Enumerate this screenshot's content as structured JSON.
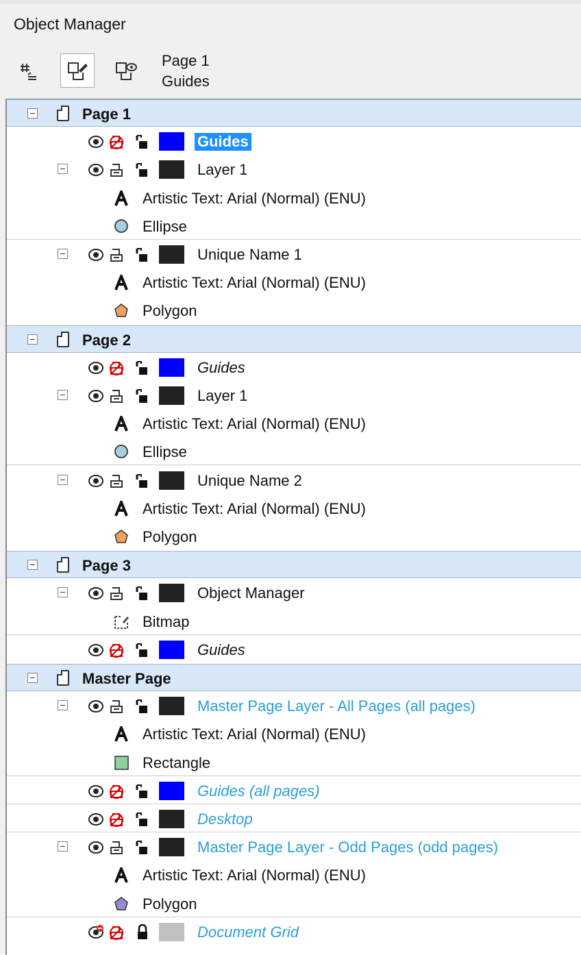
{
  "panel": {
    "title": "Object Manager"
  },
  "toolbar": {
    "info_line1": "Page 1",
    "info_line2": "Guides",
    "buttons": [
      "object-properties",
      "layer-manager-view",
      "show-hide-view"
    ]
  },
  "colors": {
    "page_row_bg": "#d9e8f8",
    "selection": "#1e90ff",
    "master_text": "#2aa0d8",
    "guides_swatch": "#0000ff",
    "layer_swatch": "#222222",
    "grid_swatch": "#c0c0c0"
  },
  "tree": [
    {
      "kind": "page",
      "label": "Page 1"
    },
    {
      "kind": "layer",
      "label": "Guides",
      "style": "selected",
      "swatch": "#0000ff",
      "guide": true,
      "expander": false
    },
    {
      "kind": "layer",
      "label": "Layer 1",
      "style": "normal",
      "swatch": "#222222",
      "guide": false,
      "expander": true
    },
    {
      "kind": "object",
      "label": "Artistic Text: Arial (Normal) (ENU)",
      "icon": "text-icon"
    },
    {
      "kind": "object",
      "label": "Ellipse",
      "icon": "ellipse-icon",
      "sep": true
    },
    {
      "kind": "layer",
      "label": "Unique Name 1",
      "style": "normal",
      "swatch": "#222222",
      "guide": false,
      "expander": true
    },
    {
      "kind": "object",
      "label": "Artistic Text: Arial (Normal) (ENU)",
      "icon": "text-icon"
    },
    {
      "kind": "object",
      "label": "Polygon",
      "icon": "polygon-orange-icon"
    },
    {
      "kind": "page",
      "label": "Page 2"
    },
    {
      "kind": "layer",
      "label": "Guides",
      "style": "italic",
      "swatch": "#0000ff",
      "guide": true,
      "expander": false
    },
    {
      "kind": "layer",
      "label": "Layer 1",
      "style": "normal",
      "swatch": "#222222",
      "guide": false,
      "expander": true
    },
    {
      "kind": "object",
      "label": "Artistic Text: Arial (Normal) (ENU)",
      "icon": "text-icon"
    },
    {
      "kind": "object",
      "label": "Ellipse",
      "icon": "ellipse-icon",
      "sep": true
    },
    {
      "kind": "layer",
      "label": "Unique Name 2",
      "style": "normal",
      "swatch": "#222222",
      "guide": false,
      "expander": true
    },
    {
      "kind": "object",
      "label": "Artistic Text: Arial (Normal) (ENU)",
      "icon": "text-icon"
    },
    {
      "kind": "object",
      "label": "Polygon",
      "icon": "polygon-orange-icon"
    },
    {
      "kind": "page",
      "label": "Page 3"
    },
    {
      "kind": "layer",
      "label": "Object Manager",
      "style": "normal",
      "swatch": "#222222",
      "guide": false,
      "expander": true
    },
    {
      "kind": "object",
      "label": "Bitmap",
      "icon": "bitmap-icon",
      "sep": true
    },
    {
      "kind": "layer",
      "label": "Guides",
      "style": "italic",
      "swatch": "#0000ff",
      "guide": true,
      "expander": false
    },
    {
      "kind": "page",
      "label": "Master Page"
    },
    {
      "kind": "layer",
      "label": "Master Page Layer - All Pages (all pages)",
      "style": "blue",
      "swatch": "#222222",
      "guide": false,
      "expander": true
    },
    {
      "kind": "object",
      "label": "Artistic Text: Arial (Normal) (ENU)",
      "icon": "text-icon"
    },
    {
      "kind": "object",
      "label": "Rectangle",
      "icon": "rectangle-icon",
      "sep": true
    },
    {
      "kind": "layer",
      "label": "Guides (all pages)",
      "style": "blue-italic",
      "swatch": "#0000ff",
      "guide": true,
      "expander": false,
      "sep": true
    },
    {
      "kind": "layer",
      "label": "Desktop",
      "style": "blue-italic",
      "swatch": "#222222",
      "guide": true,
      "expander": false,
      "sep": true
    },
    {
      "kind": "layer",
      "label": "Master Page Layer - Odd Pages (odd pages)",
      "style": "blue",
      "swatch": "#222222",
      "guide": false,
      "expander": true
    },
    {
      "kind": "object",
      "label": "Artistic Text: Arial (Normal) (ENU)",
      "icon": "text-icon"
    },
    {
      "kind": "object",
      "label": "Polygon",
      "icon": "polygon-purple-icon",
      "sep": true
    },
    {
      "kind": "layer",
      "label": "Document Grid",
      "style": "blue-italic",
      "swatch": "#c0c0c0",
      "guide": true,
      "expander": false,
      "hidden": true
    }
  ]
}
